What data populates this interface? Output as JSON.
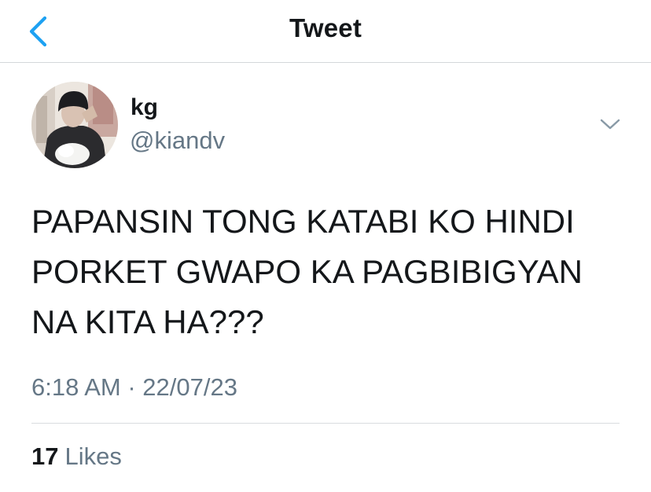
{
  "header": {
    "title": "Tweet",
    "back_icon": "chevron-left-icon",
    "accent_color": "#1da1f2"
  },
  "author": {
    "display_name": "kg",
    "handle": "@kiandv",
    "more_icon": "chevron-down-icon"
  },
  "tweet": {
    "lines": [
      "PAPANSIN TONG KATABI KO HINDI",
      "PORKET GWAPO KA PAGBIBIGYAN",
      "NA KITA HA???"
    ],
    "timestamp": "6:18 AM · 22/07/23"
  },
  "stats": {
    "likes_count": "17",
    "likes_label": "Likes"
  }
}
